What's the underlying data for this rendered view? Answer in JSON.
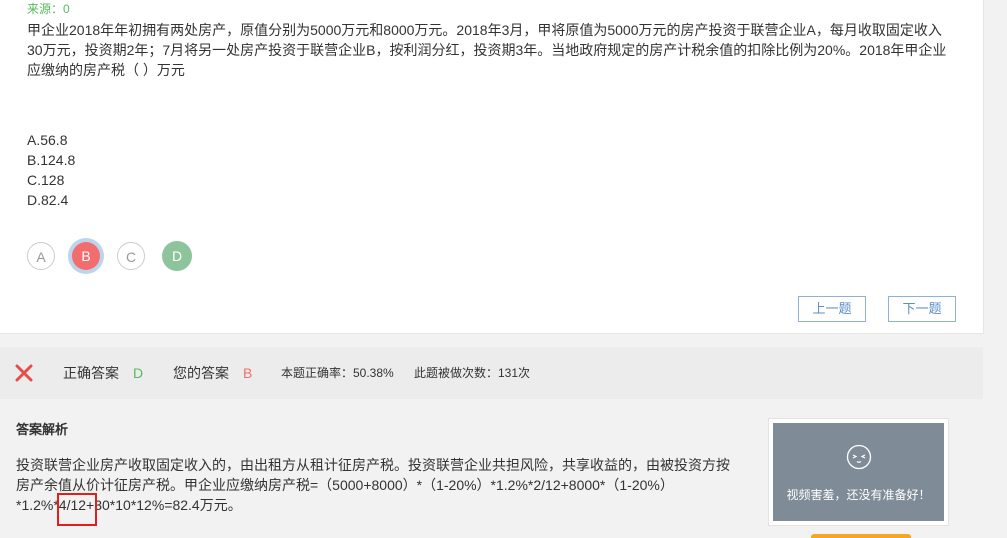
{
  "question": {
    "source": "来源：0",
    "text": "甲企业2018年年初拥有两处房产，原值分别为5000万元和8000万元。2018年3月，甲将原值为5000万元的房产投资于联营企业A，每月收取固定收入30万元，投资期2年；7月将另一处房产投资于联营企业B，按利润分红，投资期3年。当地政府规定的房产计税余值的扣除比例为20%。2018年甲企业应缴纳的房产税（ ）万元",
    "options": [
      "A.56.8",
      "B.124.8",
      "C.128",
      "D.82.4"
    ],
    "choices": [
      "A",
      "B",
      "C",
      "D"
    ],
    "prev_label": "上一题",
    "next_label": "下一题"
  },
  "result": {
    "icon": "close-icon",
    "correct_label": "正确答案",
    "correct_value": "D",
    "yours_label": "您的答案",
    "yours_value": "B",
    "rate_text": "本题正确率：50.38%",
    "count_text": "此题被做次数：131次",
    "colors": {
      "correct": "#5cb85c",
      "wrong": "#f26d6d",
      "x": "#e94b4b"
    }
  },
  "analysis": {
    "title": "答案解析",
    "text": "投资联营企业房产收取固定收入的，由出租方从租计征房产税。投资联营企业共担风险，共享收益的，由被投资方按房产余值从价计征房产税。甲企业应缴纳房产税=（5000+8000）*（1-20%）*1.2%*2/12+8000*（1-20%）*1.2%*4/12+30*10*12%=82.4万元。"
  },
  "video": {
    "icon": "shy-face-icon",
    "message": "视频害羞，还没有准备好！"
  }
}
